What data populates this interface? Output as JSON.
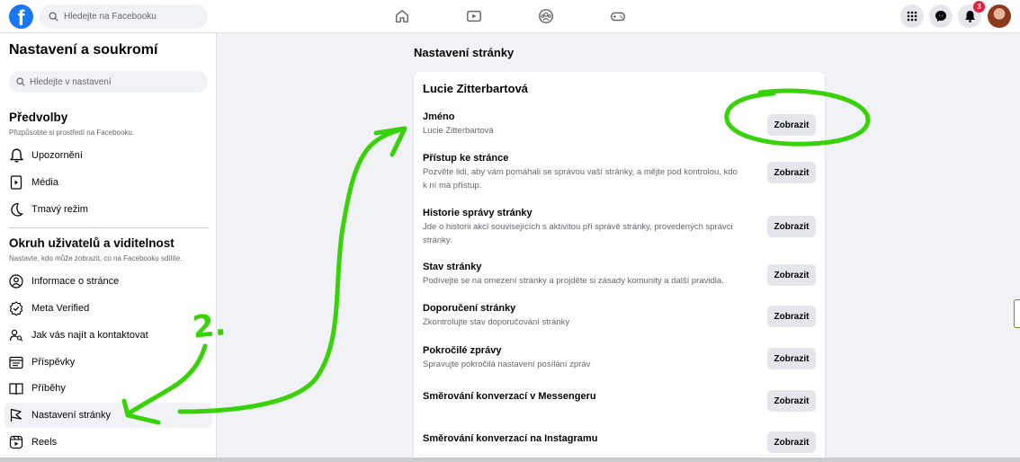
{
  "topbar": {
    "search_placeholder": "Hledejte na Facebooku",
    "notifications_count": "3",
    "logo_letter": "f"
  },
  "sidebar": {
    "title": "Nastavení a soukromí",
    "search_placeholder": "Hledejte v nastavení",
    "preferences": {
      "heading": "Předvolby",
      "subtitle": "Přizpůsobte si prostředí na Facebooku.",
      "items": [
        "Upozornění",
        "Média",
        "Tmavý režim"
      ]
    },
    "audience": {
      "heading": "Okruh uživatelů a viditelnost",
      "subtitle": "Nastavte, kdo může zobrazit, co na Facebooku sdílíte.",
      "items": [
        "Informace o stránce",
        "Meta Verified",
        "Jak vás najít a kontaktovat",
        "Příspěvky",
        "Příběhy",
        "Nastavení stránky",
        "Reels"
      ]
    }
  },
  "main": {
    "title": "Nastavení stránky",
    "card_title": "Lucie Zitterbartová",
    "button_label": "Zobrazit",
    "rows": [
      {
        "label": "Jméno",
        "desc": "Lucie Zitterbartová"
      },
      {
        "label": "Přístup ke stránce",
        "desc": "Pozvěte lidi, aby vám pomáhali se správou vaší stránky, a mějte pod kontrolou, kdo k ní má přístup."
      },
      {
        "label": "Historie správy stránky",
        "desc": "Jde o historii akcí souvisejících s aktivitou při správě stránky, provedených správci stránky."
      },
      {
        "label": "Stav stránky",
        "desc": "Podívejte se na omezení stránky a projděte si zásady komunity a další pravidla."
      },
      {
        "label": "Doporučení stránky",
        "desc": "Zkontrolujte stav doporučování stránky"
      },
      {
        "label": "Pokročilé zprávy",
        "desc": "Spravujte pokročilá nastavení posílání zpráv"
      },
      {
        "label": "Směrování konverzací v Messengeru",
        "desc": ""
      },
      {
        "label": "Směrování konverzací na Instagramu",
        "desc": ""
      }
    ]
  },
  "annotations": {
    "step_number": "2.",
    "color": "#39d20a"
  },
  "colors": {
    "brand": "#1877f2",
    "badge": "#e41e3f",
    "page_bg": "#f0f2f5"
  }
}
